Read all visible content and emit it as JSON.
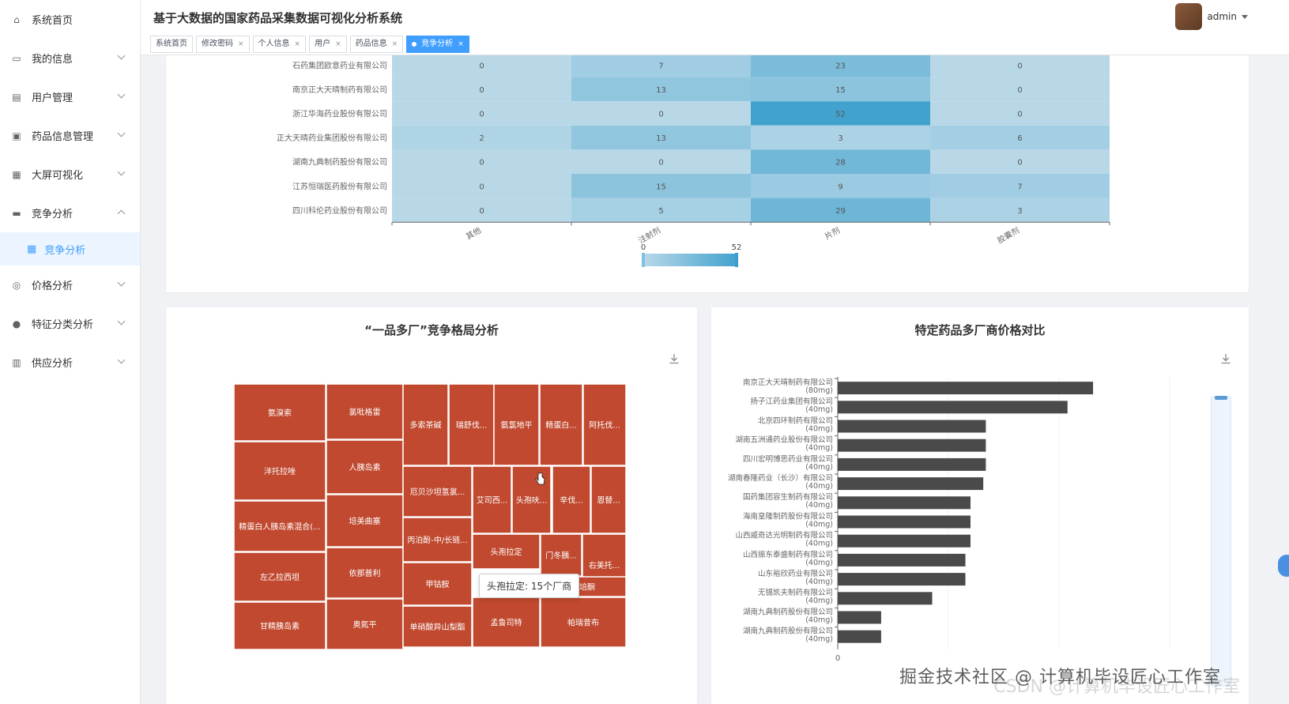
{
  "app": {
    "title": "基于大数据的国家药品采集数据可视化分析系统",
    "user": "admin"
  },
  "sidebar": {
    "items": [
      {
        "label": "系统首页",
        "icon": "home-icon",
        "expandable": false
      },
      {
        "label": "我的信息",
        "icon": "card-icon",
        "expandable": true
      },
      {
        "label": "用户管理",
        "icon": "clipboard-icon",
        "expandable": true
      },
      {
        "label": "药品信息管理",
        "icon": "medicine-icon",
        "expandable": true
      },
      {
        "label": "大屏可视化",
        "icon": "grid-icon",
        "expandable": true
      },
      {
        "label": "竞争分析",
        "icon": "ticket-icon",
        "expandable": true,
        "expanded": true
      },
      {
        "label": "价格分析",
        "icon": "target-icon",
        "expandable": true
      },
      {
        "label": "特征分类分析",
        "icon": "person-icon",
        "expandable": true
      },
      {
        "label": "供应分析",
        "icon": "chart-icon",
        "expandable": true
      }
    ],
    "subitem": {
      "label": "竞争分析",
      "icon": "grid-icon"
    }
  },
  "tabs": [
    {
      "label": "系统首页",
      "closable": false
    },
    {
      "label": "修改密码",
      "closable": true
    },
    {
      "label": "个人信息",
      "closable": true
    },
    {
      "label": "用户",
      "closable": true
    },
    {
      "label": "药品信息",
      "closable": true
    },
    {
      "label": "竞争分析",
      "closable": true,
      "active": true
    }
  ],
  "colors": {
    "accent": "#409eff",
    "treemap": "#c0492f",
    "bar": "#4a4a4a"
  },
  "chart_data": [
    {
      "type": "heatmap",
      "rows": [
        "石药集团欧意药业有限公司",
        "南京正大天晴制药有限公司",
        "浙江华海药业股份有限公司",
        "正大天晴药业集团股份有限公司",
        "湖南九典制药股份有限公司",
        "江苏恒瑞医药股份有限公司",
        "四川科伦药业股份有限公司"
      ],
      "columns": [
        "其他",
        "注射剂",
        "片剂",
        "胶囊剂"
      ],
      "values": [
        [
          0,
          7,
          23,
          0
        ],
        [
          0,
          13,
          15,
          0
        ],
        [
          0,
          0,
          52,
          0
        ],
        [
          2,
          13,
          3,
          6
        ],
        [
          0,
          0,
          28,
          0
        ],
        [
          0,
          15,
          9,
          7
        ],
        [
          0,
          5,
          29,
          3
        ]
      ],
      "visual_map": {
        "min": 0,
        "max": 52,
        "min_label": "0",
        "max_label": "52"
      }
    },
    {
      "type": "treemap",
      "title": "“一品多厂”竞争格局分析",
      "labels": [
        "氨溴索",
        "泮托拉唑",
        "精蛋白人胰岛素混合(...",
        "左乙拉西坦",
        "甘精胰岛素",
        "氯吡格雷",
        "人胰岛素",
        "培美曲塞",
        "依那普利",
        "奥氮平",
        "多索茶碱",
        "瑞舒伐...",
        "氨氯地平",
        "精蛋白...",
        "阿托伐...",
        "厄贝沙坦氢氯...",
        "艾司西...",
        "头孢呋...",
        "辛伐...",
        "恩替...",
        "丙泊酚-中/长链...",
        "头孢拉定",
        "门冬胰...",
        "右美托...",
        "甲钴胺",
        "利培酮",
        "单硝酸异山梨酯",
        "孟鲁司特",
        "帕瑞昔布"
      ],
      "tooltip": "头孢拉定: 15个厂商"
    },
    {
      "type": "bar",
      "title": "特定药品多厂商价格对比",
      "orientation": "horizontal",
      "categories": [
        [
          "南京正大天晴制药有限公司",
          "(80mg)"
        ],
        [
          "扬子江药业集团有限公司",
          "(40mg)"
        ],
        [
          "北京四环制药有限公司",
          "(40mg)"
        ],
        [
          "湖南五洲通药业股份有限公司",
          "(40mg)"
        ],
        [
          "四川宏明博思药业有限公司",
          "(40mg)"
        ],
        [
          "湖南春隆药业（长沙）有限公司",
          "(40mg)"
        ],
        [
          "国药集团容生制药有限公司",
          "(40mg)"
        ],
        [
          "海南皇隆制药股份有限公司",
          "(40mg)"
        ],
        [
          "山西威奇达光明制药有限公司",
          "(40mg)"
        ],
        [
          "山西振东泰盛制药有限公司",
          "(40mg)"
        ],
        [
          "山东裕欣药业有限公司",
          "(40mg)"
        ],
        [
          "无锡凯夫制药有限公司",
          "(40mg)"
        ],
        [
          "湖南九典制药股份有限公司",
          "(40mg)"
        ],
        [
          "湖南九典制药股份有限公司",
          "(40mg)"
        ]
      ],
      "values": [
        100,
        90,
        58,
        58,
        58,
        57,
        52,
        52,
        52,
        50,
        50,
        37,
        17,
        17
      ],
      "xlim": [
        0,
        130
      ],
      "x_tick_label": "0"
    }
  ],
  "watermark": "掘金技术社区 @ 计算机毕设匠心工作室",
  "watermark_under": "CSDN @计算机毕设匠心工作室"
}
